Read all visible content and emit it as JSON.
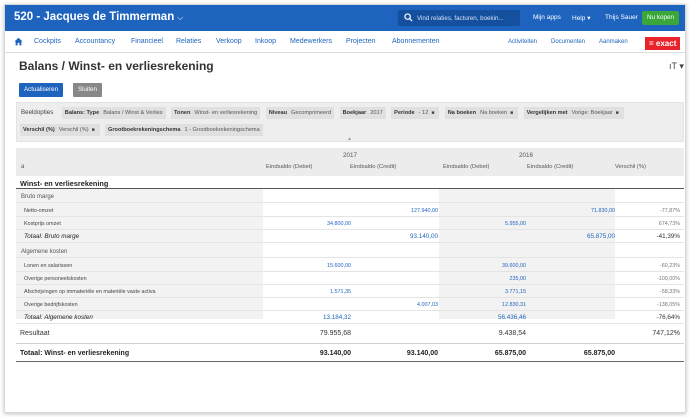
{
  "topbar": {
    "company": "520 - Jacques de Timmerman",
    "search_placeholder": "Vind relaties, facturen, boekin...",
    "my_apps": "Mijn apps",
    "help": "Help",
    "user": "Thijs Sauer",
    "buy_now": "Nu kopen"
  },
  "nav": {
    "items": [
      "Cockpits",
      "Accountancy",
      "Financieel",
      "Relaties",
      "Verkoop",
      "Inkoop",
      "Medewerkers",
      "Projecten",
      "Abonnementen"
    ],
    "right": [
      "Activiteiten",
      "Documenten",
      "Aanmaken"
    ],
    "logo": "= exact"
  },
  "page": {
    "title": "Balans / Winst- en verliesrekening",
    "title_icon": "ıT ▾",
    "refresh_button": "Actualiseren",
    "close_button": "Sluiten"
  },
  "filters": {
    "label": "Beeldopties",
    "row1": [
      {
        "key": "Balans: Type",
        "value": "Balans / Winst & Verlies"
      },
      {
        "key": "Tonen",
        "value": "Winst- en verliesrekening"
      },
      {
        "key": "Niveau",
        "value": "Gecomprimeerd"
      },
      {
        "key": "Boekjaar",
        "value": "2017"
      },
      {
        "key": "Periode",
        "value": "- 12"
      },
      {
        "key": "Na boeken",
        "value": "Na boeken"
      },
      {
        "key": "Vergelijken met",
        "value": "Vorige: Boekjaar"
      }
    ],
    "row2": [
      {
        "key": "Verschil (%)",
        "value": "Verschil (%)"
      },
      {
        "key": "Grootboekrekeningschema",
        "value": "1 - Grootboekrekeningschema"
      }
    ]
  },
  "report": {
    "sort_marker": "a",
    "years": [
      "2017",
      "2016"
    ],
    "columns": [
      "Eindsaldo (Debet)",
      "Eindsaldo (Credit)",
      "Eindsaldo (Debet)",
      "Eindsaldo (Credit)",
      "Verschil (%)"
    ],
    "section": "Winst- en verliesrekening",
    "groups": [
      {
        "name": "Bruto marge",
        "rows": [
          {
            "label": "Netto-omzet",
            "values": [
              "",
              "127.940,00",
              "",
              "71.830,00",
              "-77,87%"
            ]
          },
          {
            "label": "Kostprijs omzet",
            "values": [
              "34.800,00",
              "",
              "5.955,00",
              "",
              "674,73%"
            ]
          }
        ],
        "total": {
          "label": "Totaal: Bruto marge",
          "values": [
            "",
            "93.140,00",
            "",
            "65.875,00",
            "-41,39%"
          ]
        }
      },
      {
        "name": "Algemene kosten",
        "rows": [
          {
            "label": "Lonen en salarissen",
            "values": [
              "15.600,00",
              "",
              "39.600,00",
              "",
              "-60,23%"
            ]
          },
          {
            "label": "Overige personeelskosten",
            "values": [
              "",
              "",
              "235,00",
              "",
              "-100,00%"
            ]
          },
          {
            "label": "Afschrijvingen op immateriële en materiële vaste activa",
            "values": [
              "1.571,35",
              "",
              "3.771,15",
              "",
              "-58,33%"
            ]
          },
          {
            "label": "Overige bedrijfskosten",
            "values": [
              "",
              "4.007,03",
              "12.830,31",
              "",
              "-138,05%"
            ]
          }
        ],
        "total": {
          "label": "Totaal: Algemene kosten",
          "values": [
            "13.184,32",
            "",
            "56.436,46",
            "",
            "-76,64%"
          ]
        }
      }
    ],
    "result": {
      "label": "Resultaat",
      "values": [
        "79.955,68",
        "",
        "9.438,54",
        "",
        "747,12%"
      ]
    },
    "grand_total": {
      "label": "Totaal: Winst- en verliesrekening",
      "values": [
        "93.140,00",
        "93.140,00",
        "65.875,00",
        "65.875,00",
        ""
      ]
    }
  }
}
